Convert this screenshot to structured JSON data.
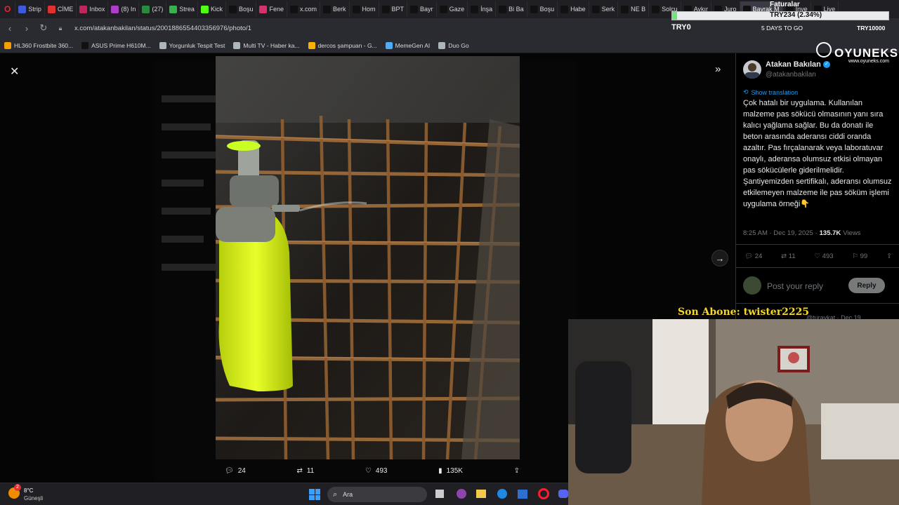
{
  "tabs": [
    {
      "label": "Strip",
      "color": "#3b5bdb"
    },
    {
      "label": "CİME",
      "color": "#e03131"
    },
    {
      "label": "Inbox",
      "color": "#c2255c"
    },
    {
      "label": "(8) In",
      "color": "#ae3ec9"
    },
    {
      "label": "(27)",
      "color": "#2b8a3e"
    },
    {
      "label": "Strea",
      "color": "#37b24d"
    },
    {
      "label": "Kick",
      "color": "#53fc18"
    },
    {
      "label": "Boşu",
      "color": "#111111"
    },
    {
      "label": "Fene",
      "color": "#d6336c"
    },
    {
      "label": "x.com",
      "color": "#111111"
    },
    {
      "label": "Berk",
      "color": "#111111"
    },
    {
      "label": "Hom",
      "color": "#111111"
    },
    {
      "label": "BPT",
      "color": "#111111"
    },
    {
      "label": "Bayr",
      "color": "#111111"
    },
    {
      "label": "Gaze",
      "color": "#111111"
    },
    {
      "label": "İnşa",
      "color": "#111111"
    },
    {
      "label": "Bi Ba",
      "color": "#111111"
    },
    {
      "label": "Boşu",
      "color": "#111111"
    },
    {
      "label": "Habe",
      "color": "#111111"
    },
    {
      "label": "Serk",
      "color": "#111111"
    },
    {
      "label": "NE B",
      "color": "#111111"
    },
    {
      "label": "Solcu",
      "color": "#111111"
    },
    {
      "label": "Aykır",
      "color": "#111111"
    },
    {
      "label": "Juro",
      "color": "#111111"
    },
    {
      "label": "Bayrak M",
      "color": "#111111"
    },
    {
      "label": "Inve",
      "color": "#111111"
    },
    {
      "label": "Live",
      "color": "#111111"
    }
  ],
  "address": {
    "url": "x.com/atakanbakilan/status/2001886554403356976/photo/1"
  },
  "bookmarks": [
    {
      "label": "HL360 Frostbite 360...",
      "color": "#f59f00"
    },
    {
      "label": "ASUS Prime H610M...",
      "color": "#111111"
    },
    {
      "label": "Yorgunluk Tespit Test",
      "color": "#adb5bd"
    },
    {
      "label": "Multi TV - Haber ka...",
      "color": "#adb5bd"
    },
    {
      "label": "dercos şampuan - G...",
      "color": "#fab005"
    },
    {
      "label": "MemeGen AI",
      "color": "#4dabf7"
    },
    {
      "label": "Duo Go",
      "color": "#adb5bd"
    }
  ],
  "ticker": {
    "title": "Faturalar",
    "value": "TRY234 (2.34%)",
    "currency": "TRY0",
    "days": "5 DAYS TO GO",
    "goal": "TRY10000"
  },
  "brand": {
    "name": "OYUNEKS",
    "site": "www.oyuneks.com"
  },
  "tweet": {
    "author_name": "Atakan Bakılan",
    "author_handle": "@atakanbakilan",
    "show_translation": "Show translation",
    "text": "Çok hatalı bir uygulama. Kullanılan malzeme pas sökücü olmasının yanı sıra kalıcı yağlama sağlar. Bu da donatı ile beton arasında aderansı ciddi oranda azaltır. Pas fırçalanarak veya laboratuvar onaylı, aderansa olumsuz etkisi olmayan pas sökücülerle giderilmelidir. Şantiyemizden sertifikalı, aderansı olumsuz etkilemeyen malzeme ile pas söküm işlemi uygulama örneği👇",
    "time": "8:25 AM · Dec 19, 2025 ·",
    "views_count": "135.7K",
    "views_label": "Views",
    "replies": "24",
    "retweets": "11",
    "likes": "493",
    "bookmarks": "99",
    "reply_placeholder": "Post your reply",
    "reply_button": "Reply",
    "next_author": "@turavkat · Dec 19"
  },
  "photo_actions": {
    "replies": "24",
    "retweets": "11",
    "likes": "493",
    "views": "135K"
  },
  "overlay": {
    "subscriber": "Son Abone: twister2225"
  },
  "taskbar": {
    "weather_temp": "8°C",
    "weather_desc": "Güneşli",
    "weather_badge": "2",
    "search_placeholder": "Ara"
  },
  "colors": {
    "accent": "#1d9bf0",
    "sub_text": "#71767b",
    "ticker_green": "#6ee77a"
  }
}
